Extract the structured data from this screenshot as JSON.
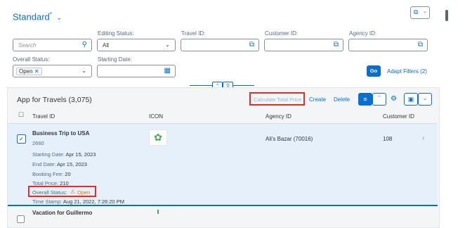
{
  "header": {
    "variant_title": "Standard",
    "variant_modified_marker": "*"
  },
  "filters": {
    "search_placeholder": "Search",
    "editing_status_label": "Editing Status:",
    "editing_status_value": "All",
    "travel_id_label": "Travel ID:",
    "customer_id_label": "Customer ID:",
    "agency_id_label": "Agency ID:",
    "overall_status_label": "Overall Status:",
    "overall_status_token": "Open",
    "starting_date_label": "Starting Date:",
    "go_label": "Go",
    "adapt_filters_label": "Adapt Filters (2)"
  },
  "table": {
    "title": "App for Travels (3,075)",
    "toolbar": {
      "calculate_label": "Calculate Total Price",
      "create_label": "Create",
      "delete_label": "Delete"
    },
    "columns": [
      "Travel ID",
      "ICON",
      "Agency ID",
      "Customer ID"
    ],
    "rows": [
      {
        "travel_name": "Business Trip to USA",
        "travel_number": "2660",
        "agency": "Ali's Bazar (70016)",
        "customer": "108",
        "details": {
          "starting_date_label": "Starting Date:",
          "starting_date": "Apr 15, 2023",
          "end_date_label": "End Date:",
          "end_date": "Apr 15, 2023",
          "booking_fee_label": "Booking Fee:",
          "booking_fee": "20",
          "total_price_label": "Total Price:",
          "total_price": "210",
          "overall_status_label": "Overall Status:",
          "overall_status": "Open",
          "time_stamp_label": "Time Stamp:",
          "time_stamp": "Aug 21, 2022, 7:26:20 PM"
        }
      },
      {
        "travel_name": "Vacation for Guillermo"
      }
    ]
  },
  "colors": {
    "accent": "#0a6ed1",
    "warning": "#e9730c",
    "highlight_border": "#d9302b",
    "table_bg": "#f3f5f7",
    "selected_row": "#e5f0fa"
  }
}
